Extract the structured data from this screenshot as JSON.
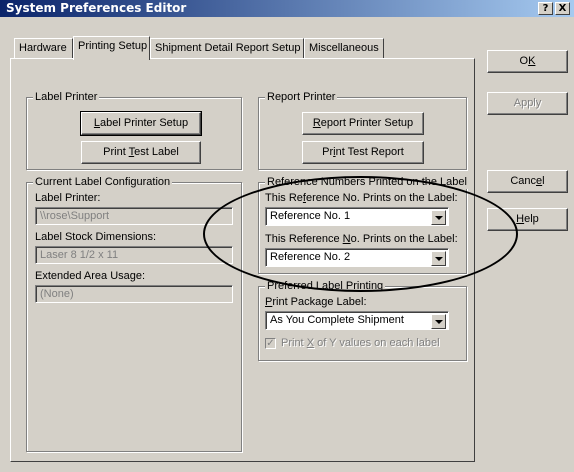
{
  "window": {
    "title": "System Preferences Editor",
    "help_btn": "?",
    "close_btn": "X"
  },
  "tabs": [
    {
      "label": "Hardware"
    },
    {
      "label": "Printing Setup",
      "active": true
    },
    {
      "label": "Shipment Detail Report Setup"
    },
    {
      "label": "Miscellaneous"
    }
  ],
  "label_printer": {
    "group": "Label Printer",
    "setup_btn": "Label Printer Setup",
    "test_btn": "Print Test Label"
  },
  "report_printer": {
    "group": "Report Printer",
    "setup_btn": "Report Printer Setup",
    "test_btn": "Print Test Report"
  },
  "current_config": {
    "group": "Current Label Configuration",
    "printer_label": "Label Printer:",
    "printer_value": "\\\\rose\\Support",
    "stock_label": "Label Stock Dimensions:",
    "stock_value": "Laser 8 1/2 x 11",
    "ext_label": "Extended Area Usage:",
    "ext_value": "(None)"
  },
  "reference": {
    "group": "Reference Numbers Printed on the Label",
    "ref1_label": "This Reference No. Prints on the Label:",
    "ref1_value": "Reference No. 1",
    "ref2_label": "This Reference No. Prints on the Label:",
    "ref2_value": "Reference No. 2"
  },
  "preferred": {
    "group": "Preferred Label Printing",
    "package_label": "Print Package Label:",
    "package_value": "As You Complete Shipment",
    "checkbox_label": "Print X of Y values on each label",
    "checkbox_checked": true
  },
  "side_buttons": {
    "ok": "OK",
    "apply": "Apply",
    "cancel": "Cancel",
    "help": "Help"
  }
}
